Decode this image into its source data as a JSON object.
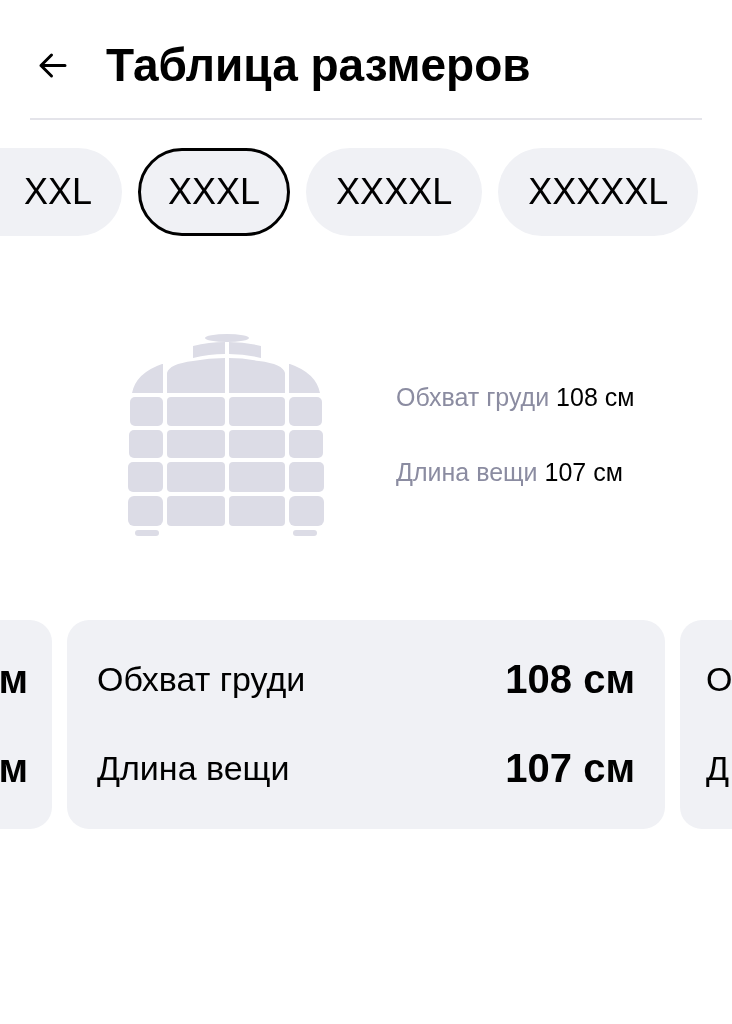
{
  "header": {
    "title": "Таблица размеров"
  },
  "sizes": [
    {
      "label": "XXL",
      "selected": false
    },
    {
      "label": "XXXL",
      "selected": true
    },
    {
      "label": "XXXXL",
      "selected": false
    },
    {
      "label": "XXXXXL",
      "selected": false
    }
  ],
  "measurements": [
    {
      "label": "Обхват груди",
      "value": "108 см"
    },
    {
      "label": "Длина вещи",
      "value": "107 см"
    }
  ],
  "cards": [
    {
      "kind": "cut_left",
      "rows": [
        {
          "value": "м"
        },
        {
          "value": "м"
        }
      ]
    },
    {
      "kind": "whole",
      "rows": [
        {
          "label": "Обхват груди",
          "value": "108 см"
        },
        {
          "label": "Длина вещи",
          "value": "107 см"
        }
      ]
    },
    {
      "kind": "cut_right",
      "rows": [
        {
          "label": "О"
        },
        {
          "label": "Д"
        }
      ]
    }
  ]
}
